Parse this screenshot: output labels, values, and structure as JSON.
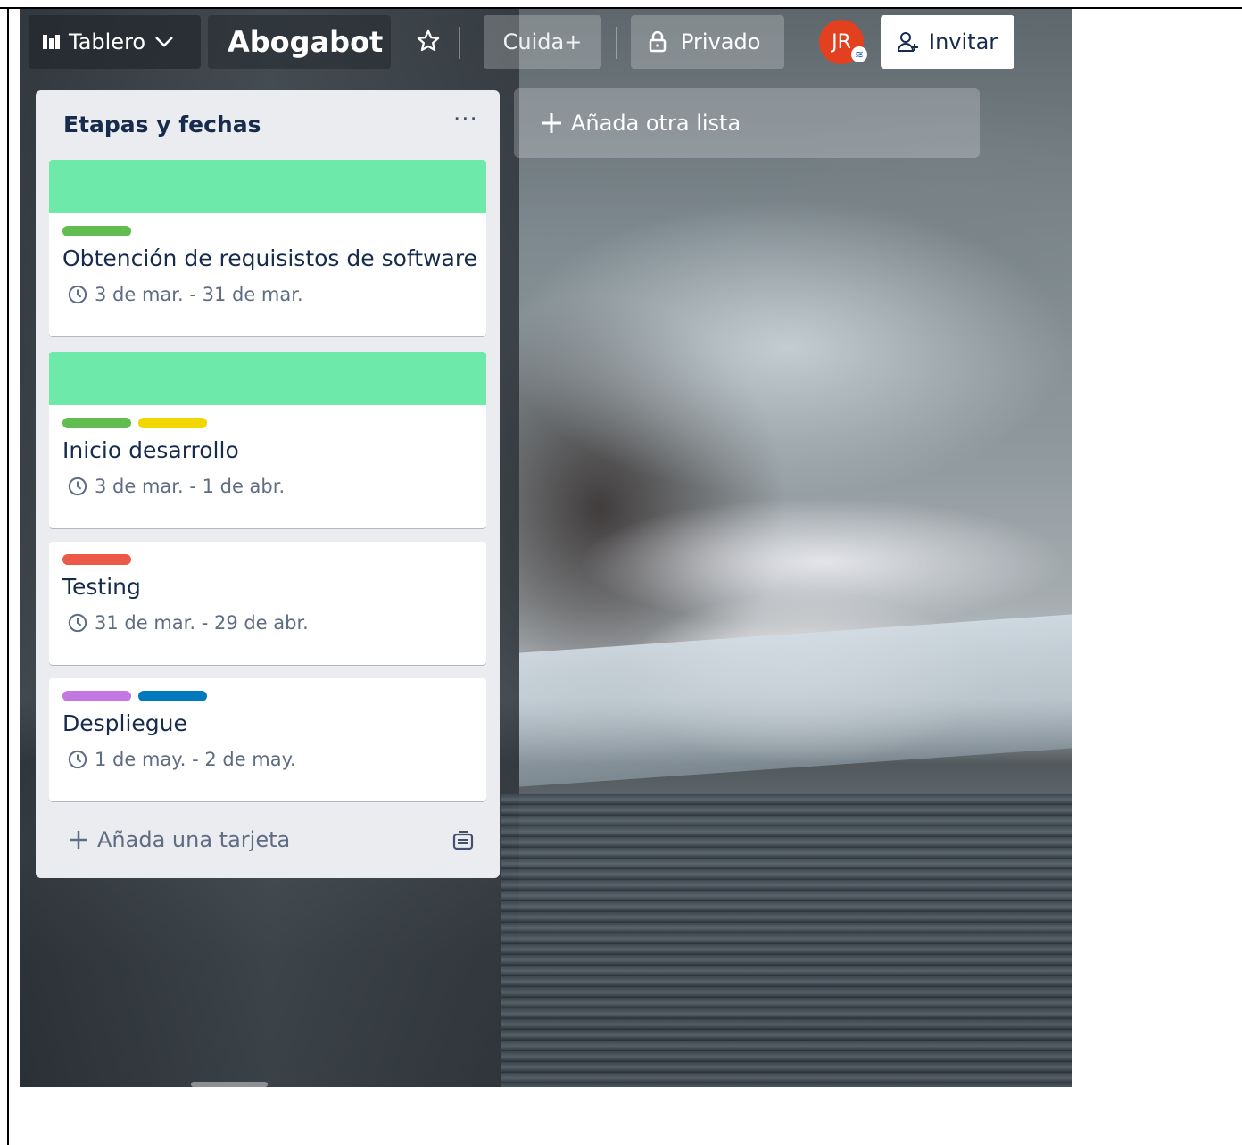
{
  "header": {
    "board_view_label": "Tablero",
    "board_title": "Abogabot",
    "workspace": "Cuida+",
    "visibility": "Privado",
    "avatar_initials": "JR",
    "invite_label": "Invitar"
  },
  "list": {
    "title": "Etapas y fechas",
    "menu": "···",
    "add_card_label": "Añada una tarjeta",
    "cards": [
      {
        "title": "Obtención de requisistos de software",
        "dates": "3 de mar. - 31 de mar.",
        "cover": "#6de9a9",
        "labels": [
          "#61bd4f"
        ]
      },
      {
        "title": "Inicio desarrollo",
        "dates": "3 de mar. - 1 de abr.",
        "cover": "#6de9a9",
        "labels": [
          "#61bd4f",
          "#f2d600"
        ]
      },
      {
        "title": "Testing",
        "dates": "31 de mar. - 29 de abr.",
        "labels": [
          "#eb5a46"
        ]
      },
      {
        "title": "Despliegue",
        "dates": "1 de may. - 2 de may.",
        "labels": [
          "#c377e0",
          "#0079bf"
        ]
      }
    ]
  },
  "add_list_label": "Añada otra lista"
}
